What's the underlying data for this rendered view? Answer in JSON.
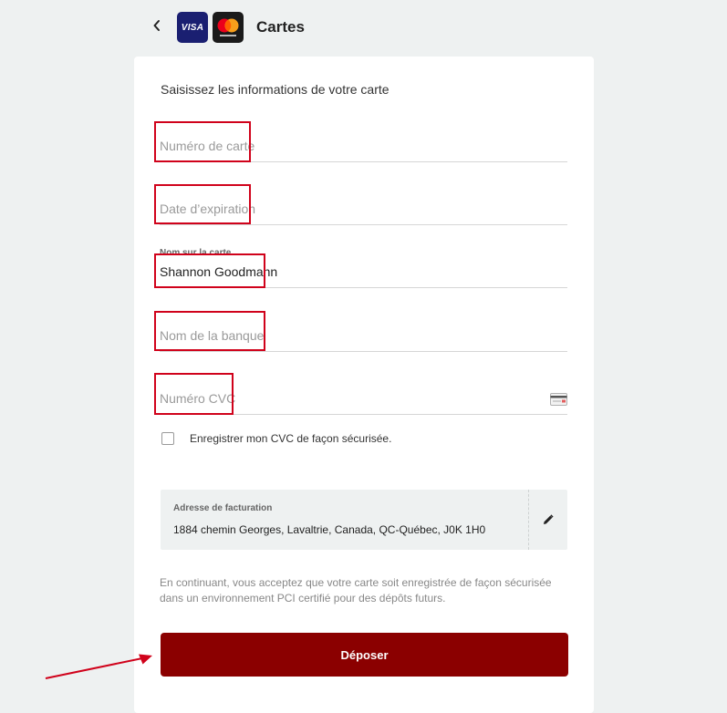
{
  "header": {
    "title": "Cartes",
    "visa_text": "VISA"
  },
  "form": {
    "intro": "Saisissez les informations de votre carte",
    "card_number": {
      "placeholder": "Numéro de carte",
      "value": ""
    },
    "expiry": {
      "placeholder": "Date d’expiration",
      "value": ""
    },
    "name": {
      "label": "Nom sur la carte",
      "value": "Shannon Goodmann"
    },
    "bank": {
      "placeholder": "Nom de la banque",
      "value": ""
    },
    "cvc": {
      "placeholder": "Numéro CVC",
      "value": ""
    },
    "save_cvc_label": "Enregistrer mon CVC de façon sécurisée.",
    "save_cvc_checked": false
  },
  "billing": {
    "label": "Adresse de facturation",
    "address": "1884 chemin Georges, Lavaltrie, Canada, QC-Québec, J0K 1H0"
  },
  "disclaimer": "En continuant, vous acceptez que votre carte soit enregistrée de façon sécurisée dans un environnement PCI certifié pour des dépôts futurs.",
  "submit_label": "Déposer",
  "colors": {
    "primary_button": "#8b0000",
    "highlight": "#d0021b",
    "background": "#eef1f1"
  },
  "icons": [
    "back-chevron-icon",
    "visa-logo",
    "mastercard-logo",
    "card-cvc-icon",
    "pencil-icon",
    "annotation-arrow"
  ]
}
